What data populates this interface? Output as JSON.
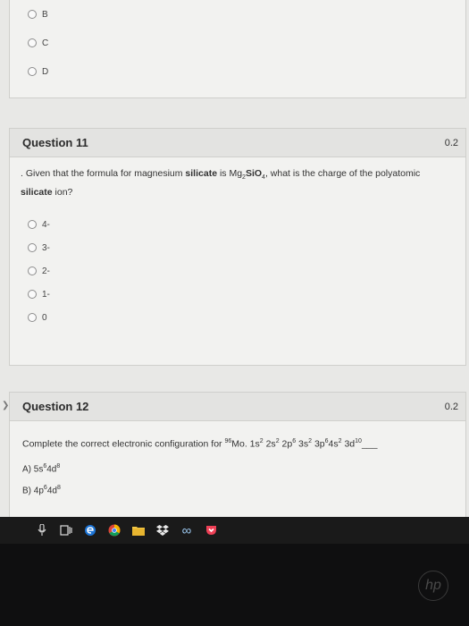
{
  "previous_question": {
    "options": [
      "B",
      "C",
      "D"
    ]
  },
  "question11": {
    "title": "Question 11",
    "points": "0.2",
    "prompt_before": ". Given that the formula for magnesium ",
    "prompt_bold1": "silicate",
    "prompt_mid": " is Mg",
    "formula_sub1": "2",
    "formula_sio": "SiO",
    "formula_sub2": "4",
    "prompt_after": ", what is the charge of the polyatomic ",
    "prompt_bold2": "silicate",
    "prompt_end": " ion?",
    "options": [
      "4-",
      "3-",
      "2-",
      "1-",
      "0"
    ]
  },
  "question12": {
    "title": "Question 12",
    "points": "0.2",
    "prompt": "Complete the correct electronic configuration for ",
    "isotope_mass": "96",
    "element": "Mo. ",
    "config": [
      {
        "base": "1s",
        "sup": "2"
      },
      {
        "base": " 2s",
        "sup": "2"
      },
      {
        "base": " 2p",
        "sup": "6"
      },
      {
        "base": " 3s",
        "sup": "2"
      },
      {
        "base": " 3p",
        "sup": "6"
      },
      {
        "base": "4s",
        "sup": "2"
      },
      {
        "base": " 3d",
        "sup": "10"
      }
    ],
    "blank": "___",
    "answers": [
      {
        "label": "A) 5s",
        "s_sup": "6",
        "d": "4d",
        "d_sup": "8"
      },
      {
        "label": "B) 4p",
        "s_sup": "6",
        "d": "4d",
        "d_sup": "8"
      }
    ]
  },
  "taskbar": {
    "icons": [
      "mic-icon",
      "task-view-icon",
      "edge-icon",
      "chrome-icon",
      "file-explorer-icon",
      "dropbox-icon",
      "infinity-icon",
      "pocket-icon"
    ]
  },
  "brand": "hp"
}
